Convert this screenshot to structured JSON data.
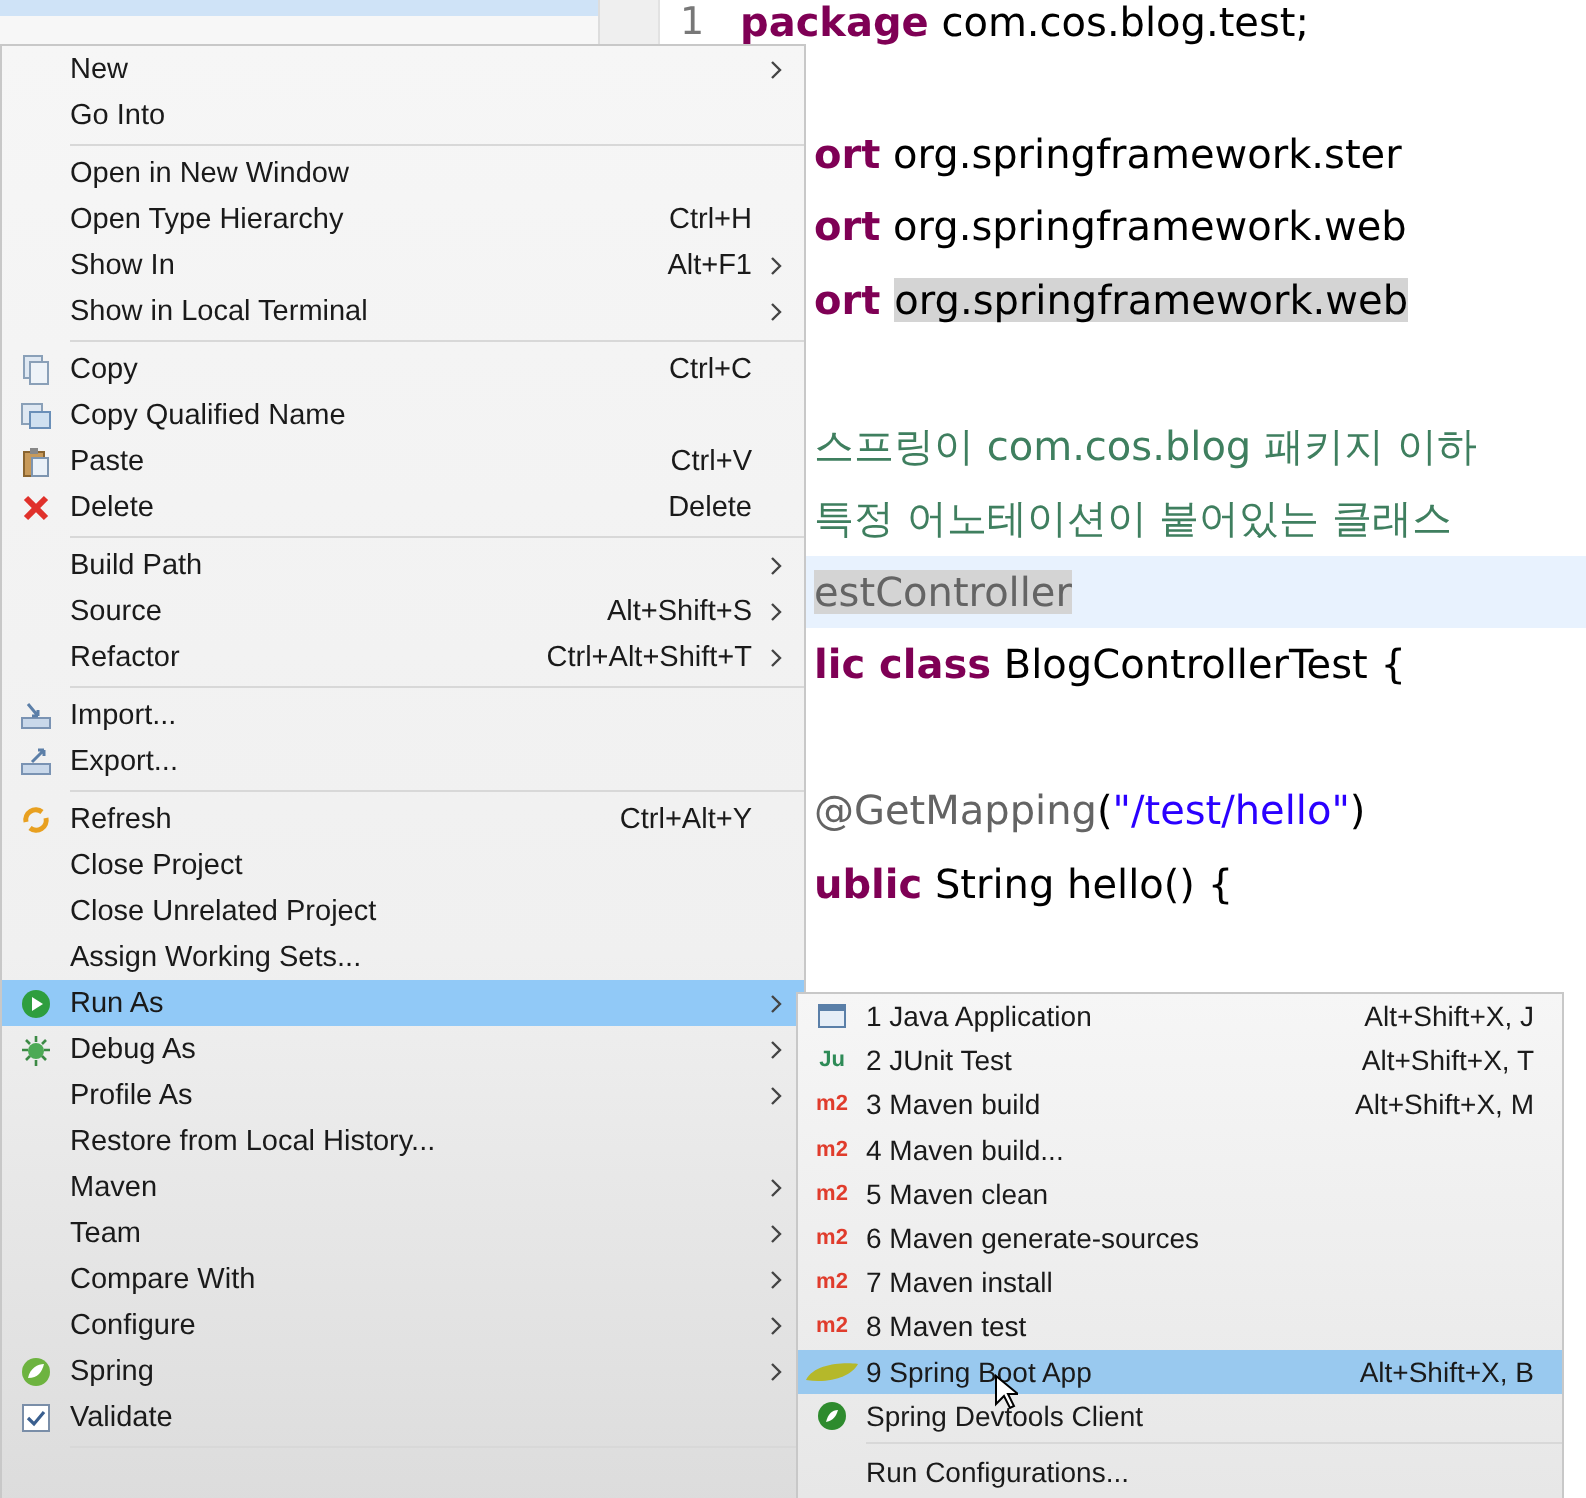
{
  "editor": {
    "lines": [
      {
        "number": "1",
        "current": false,
        "segments": [
          {
            "text": "package",
            "kind": "keyword",
            "highlighted": false
          },
          {
            "text": " com.cos.blog.test;",
            "kind": "plain",
            "highlighted": false
          }
        ]
      },
      {
        "current": false
      },
      {
        "current": false,
        "segments": [
          {
            "text": "ort",
            "kind": "keyword",
            "highlighted": false
          },
          {
            "text": " org.springframework.ster",
            "kind": "plain",
            "highlighted": false
          }
        ]
      },
      {
        "current": false,
        "segments": [
          {
            "text": "ort",
            "kind": "keyword",
            "highlighted": false
          },
          {
            "text": " org.springframework.web",
            "kind": "plain",
            "highlighted": false
          }
        ]
      },
      {
        "current": false,
        "segments": [
          {
            "text": "ort",
            "kind": "keyword",
            "highlighted": false
          },
          {
            "text": "org.springframework.web",
            "kind": "plain",
            "highlighted": true
          }
        ]
      },
      {
        "current": false
      },
      {
        "current": false,
        "segments": [
          {
            "text": "스프링이 com.cos.blog 패키지 이하",
            "kind": "comment",
            "highlighted": false
          }
        ]
      },
      {
        "current": false,
        "segments": [
          {
            "text": "특정 어노테이션이 붙어있는 클래스",
            "kind": "comment",
            "highlighted": false
          }
        ]
      },
      {
        "current": true,
        "segments": [
          {
            "text": "estController",
            "kind": "annotation",
            "highlighted": true
          }
        ]
      },
      {
        "current": false,
        "segments": [
          {
            "text": "lic class",
            "kind": "keyword",
            "highlighted": false
          },
          {
            "text": " BlogControllerTest {",
            "kind": "plain",
            "highlighted": false
          }
        ]
      },
      {
        "current": false
      },
      {
        "current": false,
        "segments": [
          {
            "text": "@GetMapping",
            "kind": "annotation",
            "highlighted": false
          },
          {
            "text": "(",
            "kind": "plain",
            "highlighted": false
          },
          {
            "text": "\"/test/hello\"",
            "kind": "string",
            "highlighted": false
          },
          {
            "text": ")",
            "kind": "plain",
            "highlighted": false
          }
        ]
      },
      {
        "current": false,
        "segments": [
          {
            "text": "ublic",
            "kind": "keyword",
            "highlighted": false
          },
          {
            "text": " String hello() {",
            "kind": "plain",
            "highlighted": false
          }
        ]
      }
    ]
  },
  "context_menu": {
    "items": [
      {
        "kind": "item",
        "label": "New",
        "submenu": true,
        "selected": false
      },
      {
        "kind": "item",
        "label": "Go Into",
        "submenu": false,
        "selected": false
      },
      {
        "kind": "separator"
      },
      {
        "kind": "item",
        "label": "Open in New Window",
        "submenu": false,
        "selected": false
      },
      {
        "kind": "item",
        "label": "Open Type Hierarchy",
        "shortcut": "Ctrl+H",
        "submenu": false,
        "selected": false
      },
      {
        "kind": "item",
        "label": "Show In",
        "shortcut": "Alt+F1",
        "submenu": true,
        "selected": false
      },
      {
        "kind": "item",
        "label": "Show in Local Terminal",
        "submenu": true,
        "selected": false
      },
      {
        "kind": "separator"
      },
      {
        "kind": "item",
        "label": "Copy",
        "shortcut": "Ctrl+C",
        "submenu": false,
        "selected": false
      },
      {
        "kind": "item",
        "label": "Copy Qualified Name",
        "submenu": false,
        "selected": false
      },
      {
        "kind": "item",
        "label": "Paste",
        "shortcut": "Ctrl+V",
        "submenu": false,
        "selected": false
      },
      {
        "kind": "item",
        "label": "Delete",
        "shortcut": "Delete",
        "submenu": false,
        "selected": false
      },
      {
        "kind": "separator"
      },
      {
        "kind": "item",
        "label": "Build Path",
        "submenu": true,
        "selected": false
      },
      {
        "kind": "item",
        "label": "Source",
        "shortcut": "Alt+Shift+S",
        "submenu": true,
        "selected": false
      },
      {
        "kind": "item",
        "label": "Refactor",
        "shortcut": "Ctrl+Alt+Shift+T",
        "submenu": true,
        "selected": false
      },
      {
        "kind": "separator"
      },
      {
        "kind": "item",
        "label": "Import...",
        "submenu": false,
        "selected": false
      },
      {
        "kind": "item",
        "label": "Export...",
        "submenu": false,
        "selected": false
      },
      {
        "kind": "separator"
      },
      {
        "kind": "item",
        "label": "Refresh",
        "shortcut": "Ctrl+Alt+Y",
        "submenu": false,
        "selected": false
      },
      {
        "kind": "item",
        "label": "Close Project",
        "submenu": false,
        "selected": false
      },
      {
        "kind": "item",
        "label": "Close Unrelated Project",
        "submenu": false,
        "selected": false
      },
      {
        "kind": "item",
        "label": "Assign Working Sets...",
        "submenu": false,
        "selected": false
      },
      {
        "kind": "item",
        "label": "Run As",
        "submenu": true,
        "selected": true
      },
      {
        "kind": "item",
        "label": "Debug As",
        "submenu": true,
        "selected": false
      },
      {
        "kind": "item",
        "label": "Profile As",
        "submenu": true,
        "selected": false
      },
      {
        "kind": "item",
        "label": "Restore from Local History...",
        "submenu": false,
        "selected": false
      },
      {
        "kind": "item",
        "label": "Maven",
        "submenu": true,
        "selected": false
      },
      {
        "kind": "item",
        "label": "Team",
        "submenu": true,
        "selected": false
      },
      {
        "kind": "item",
        "label": "Compare With",
        "submenu": true,
        "selected": false
      },
      {
        "kind": "item",
        "label": "Configure",
        "submenu": true,
        "selected": false
      },
      {
        "kind": "item",
        "label": "Spring",
        "submenu": true,
        "selected": false
      },
      {
        "kind": "item",
        "label": "Validate",
        "submenu": false,
        "selected": false
      },
      {
        "kind": "separator"
      }
    ]
  },
  "run_as_submenu": {
    "items": [
      {
        "kind": "item",
        "label": "1 Java Application",
        "shortcut": "Alt+Shift+X, J",
        "selected": false
      },
      {
        "kind": "item",
        "label": "2 JUnit Test",
        "shortcut": "Alt+Shift+X, T",
        "icon_text": "Ju",
        "selected": false
      },
      {
        "kind": "item",
        "label": "3 Maven build",
        "shortcut": "Alt+Shift+X, M",
        "icon_text": "m2",
        "selected": false
      },
      {
        "kind": "item",
        "label": "4 Maven build...",
        "icon_text": "m2",
        "selected": false
      },
      {
        "kind": "item",
        "label": "5 Maven clean",
        "icon_text": "m2",
        "selected": false
      },
      {
        "kind": "item",
        "label": "6 Maven generate-sources",
        "icon_text": "m2",
        "selected": false
      },
      {
        "kind": "item",
        "label": "7 Maven install",
        "icon_text": "m2",
        "selected": false
      },
      {
        "kind": "item",
        "label": "8 Maven test",
        "icon_text": "m2",
        "selected": false
      },
      {
        "kind": "item",
        "label": "9 Spring Boot App",
        "shortcut": "Alt+Shift+X, B",
        "selected": true
      },
      {
        "kind": "item",
        "label": "Spring Devtools Client",
        "selected": false
      },
      {
        "kind": "separator"
      },
      {
        "kind": "item",
        "label": "Run Configurations...",
        "selected": false
      }
    ]
  }
}
